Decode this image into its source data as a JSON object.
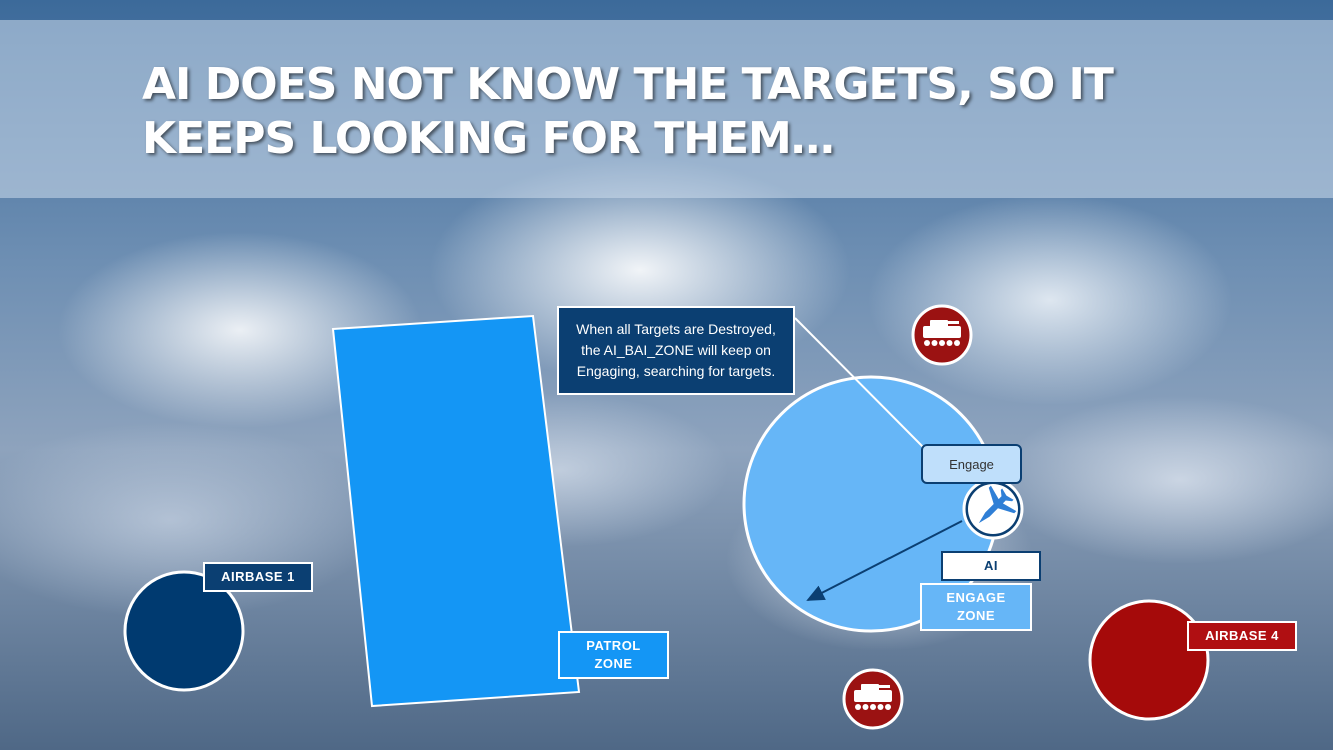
{
  "title": "AI DOES NOT KNOW THE TARGETS, SO IT KEEPS LOOKING FOR THEM…",
  "callout": {
    "lines": [
      "When all Targets are Destroyed,",
      "the AI_BAI_ZONE will keep on",
      "Engaging, searching for targets."
    ]
  },
  "labels": {
    "airbase1": "AIRBASE 1",
    "airbase4": "AIRBASE 4",
    "patrol_zone": [
      "PATROL",
      "ZONE"
    ],
    "engage_zone": [
      "ENGAGE",
      "ZONE"
    ],
    "engage": "Engage",
    "ai": "AI"
  },
  "icons": {
    "aircraft": "jet-fighter-icon",
    "target": "armored-vehicle-icon"
  },
  "colors": {
    "airbase1": "#003a70",
    "airbase4": "#a50a0a",
    "patrol_zone": "#1496f5",
    "engage_zone": "#66b6f7",
    "callout_bg": "#0b3f72",
    "label_navy": "#0b3f72",
    "label_red": "#b00f12",
    "target_red": "#9b1212"
  }
}
